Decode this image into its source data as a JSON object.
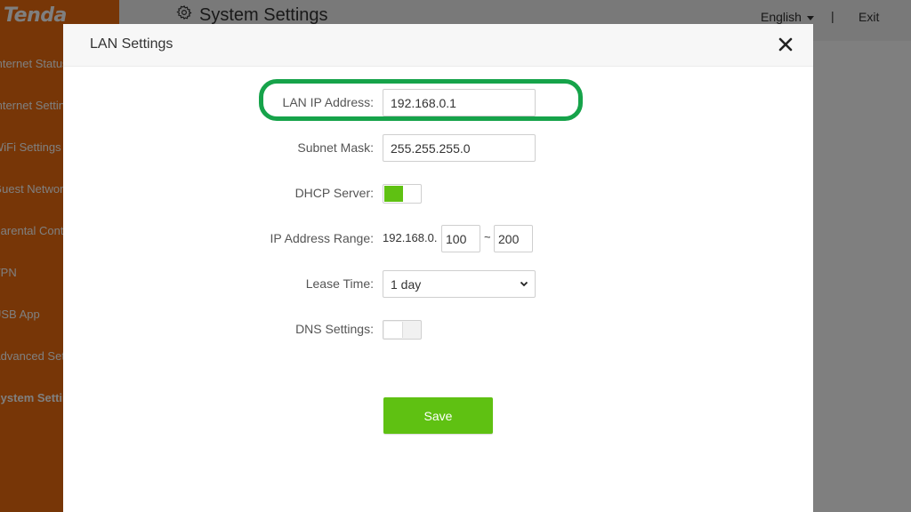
{
  "app": {
    "logo": "Tenda",
    "page_title": "System Settings",
    "language": "English",
    "separator": "|",
    "exit_label": "Exit"
  },
  "sidebar": {
    "items": [
      {
        "label": "Internet Status"
      },
      {
        "label": "Internet Settings"
      },
      {
        "label": "WiFi Settings"
      },
      {
        "label": "Guest Network"
      },
      {
        "label": "Parental Control"
      },
      {
        "label": "VPN"
      },
      {
        "label": "USB App"
      },
      {
        "label": "Advanced Settings"
      },
      {
        "label": "System Settings"
      }
    ],
    "active_index": 8
  },
  "modal": {
    "title": "LAN Settings",
    "lan_ip": {
      "label": "LAN IP Address:",
      "value": "192.168.0.1"
    },
    "subnet": {
      "label": "Subnet Mask:",
      "value": "255.255.255.0"
    },
    "dhcp": {
      "label": "DHCP Server:",
      "enabled": true
    },
    "ip_range": {
      "label": "IP Address Range:",
      "prefix": "192.168.0.",
      "start": "100",
      "separator": "~",
      "end": "200"
    },
    "lease": {
      "label": "Lease Time:",
      "value": "1 day",
      "options": [
        "1 day"
      ]
    },
    "dns": {
      "label": "DNS Settings:",
      "enabled": false
    },
    "save_label": "Save"
  },
  "colors": {
    "brand_orange": "#ee6d0e",
    "accent_green": "#5fc112",
    "highlight_green": "#16a34a"
  }
}
